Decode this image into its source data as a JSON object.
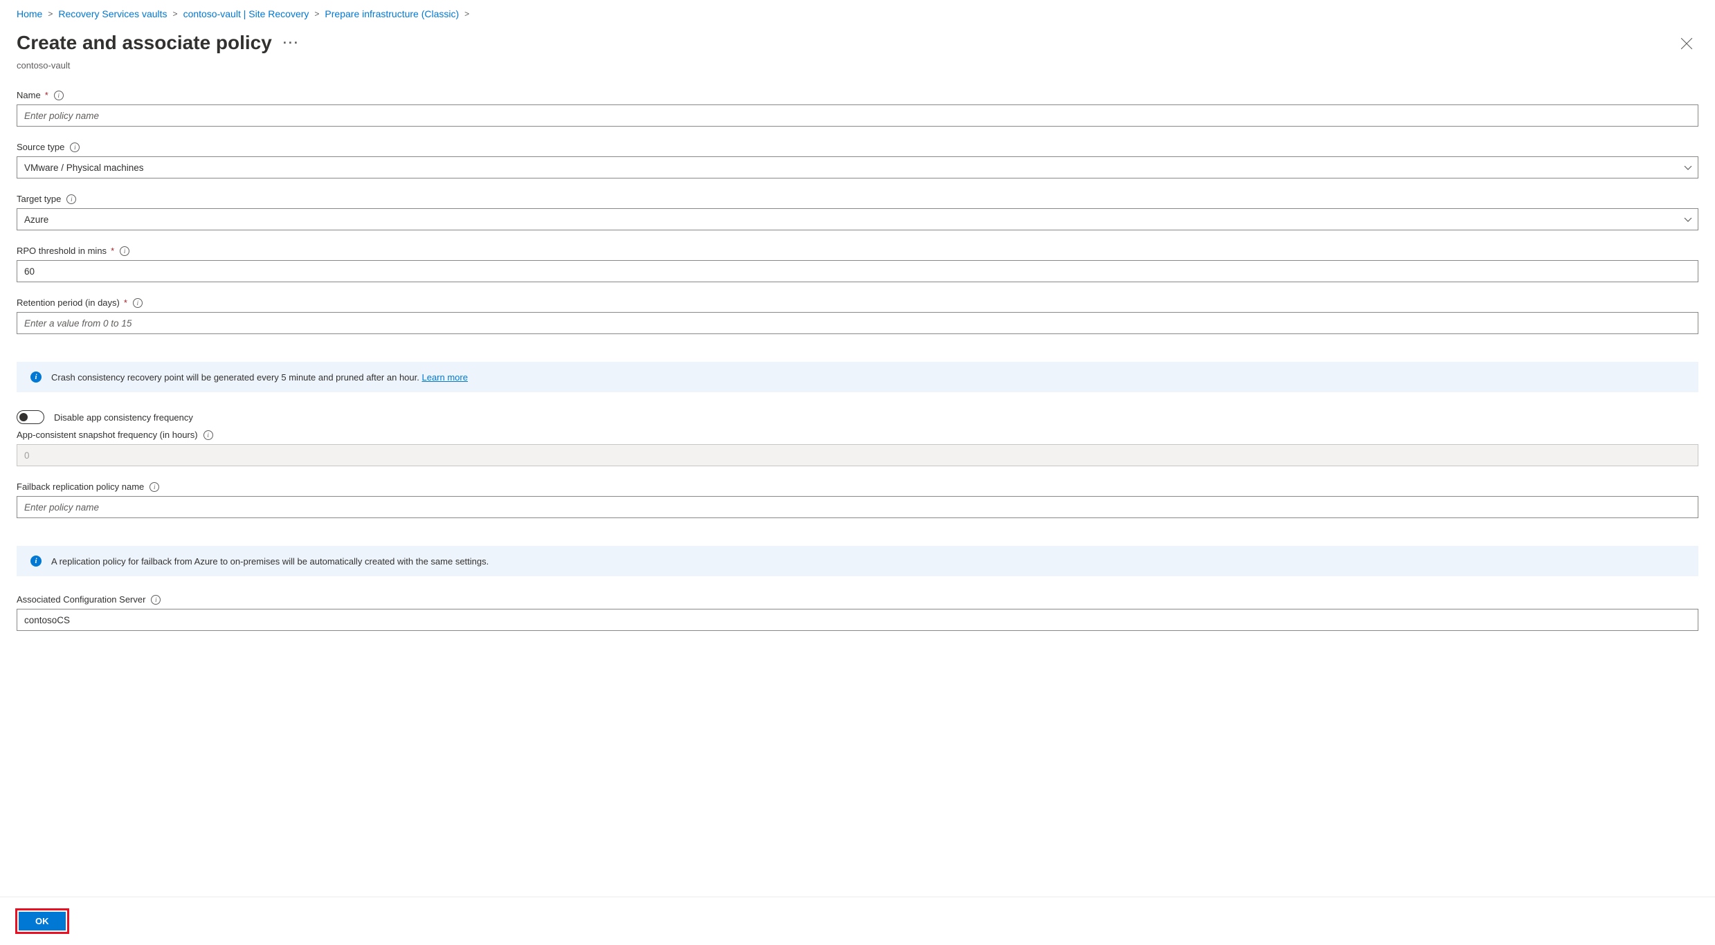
{
  "breadcrumb": [
    "Home",
    "Recovery Services vaults",
    "contoso-vault | Site Recovery",
    "Prepare infrastructure (Classic)"
  ],
  "page_title": "Create and associate policy",
  "subtitle": "contoso-vault",
  "fields": {
    "name": {
      "label": "Name",
      "placeholder": "Enter policy name",
      "value": ""
    },
    "source_type": {
      "label": "Source type",
      "value": "VMware / Physical machines"
    },
    "target_type": {
      "label": "Target type",
      "value": "Azure"
    },
    "rpo": {
      "label": "RPO threshold in mins",
      "value": "60"
    },
    "retention": {
      "label": "Retention period (in days)",
      "placeholder": "Enter a value from 0 to 15",
      "value": ""
    },
    "disable_app_consistency_label": "Disable app consistency frequency",
    "app_consistent": {
      "label": "App-consistent snapshot frequency (in hours)",
      "value": "0"
    },
    "failback": {
      "label": "Failback replication policy name",
      "placeholder": "Enter policy name",
      "value": ""
    },
    "assoc_server": {
      "label": "Associated Configuration Server",
      "value": "contosoCS"
    }
  },
  "banner1_text": "Crash consistency recovery point will be generated every 5 minute and pruned after an hour. ",
  "banner1_link": "Learn more",
  "banner2_text": "A replication policy for failback from Azure to on-premises will be automatically created with the same settings.",
  "ok_label": "OK"
}
